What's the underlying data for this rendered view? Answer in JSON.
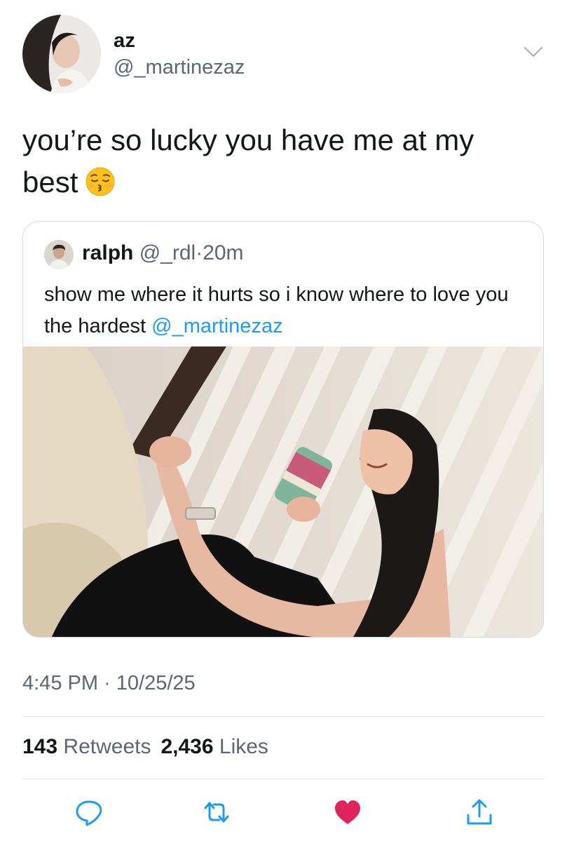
{
  "tweet": {
    "display_name": "az",
    "handle": "@_martinezaz",
    "text": "you’re so lucky you have me at my best",
    "emoji": "kissing-face-with-closed-eyes",
    "timestamp": "4:45 PM · 10/25/25"
  },
  "quoted": {
    "display_name": "ralph",
    "handle": "@_rdl",
    "separator": "·",
    "age": "20m",
    "text": "show me where it hurts so i know where to love you the hardest",
    "mention": "@_martinezaz"
  },
  "stats": {
    "retweets_count": "143",
    "retweets_label": "Retweets",
    "likes_count": "2,436",
    "likes_label": "Likes"
  },
  "colors": {
    "accent": "#1d9bf0",
    "like": "#e0245e",
    "icon": "#1d9bf0",
    "secondary_text": "#5b6670"
  },
  "actions": [
    "reply-icon",
    "retweet-icon",
    "like-icon",
    "share-icon"
  ]
}
